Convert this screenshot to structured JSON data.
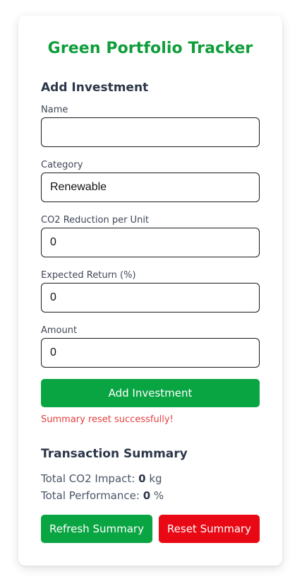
{
  "app": {
    "title": "Green Portfolio Tracker"
  },
  "form": {
    "heading": "Add Investment",
    "fields": {
      "name": {
        "label": "Name",
        "value": ""
      },
      "category": {
        "label": "Category",
        "value": "Renewable"
      },
      "co2": {
        "label": "CO2 Reduction per Unit",
        "value": "0"
      },
      "expected_return": {
        "label": "Expected Return (%)",
        "value": "0"
      },
      "amount": {
        "label": "Amount",
        "value": "0"
      }
    },
    "submit_label": "Add Investment",
    "status_message": "Summary reset successfully!"
  },
  "summary": {
    "heading": "Transaction Summary",
    "co2_label": "Total CO2 Impact:",
    "co2_value": "0",
    "co2_unit": "kg",
    "performance_label": "Total Performance:",
    "performance_value": "0",
    "performance_unit": "%",
    "refresh_label": "Refresh Summary",
    "reset_label": "Reset Summary"
  },
  "colors": {
    "brand_green": "#0f9d3a",
    "button_green": "#0aa543",
    "button_red": "#e80914",
    "error_text": "#e53e3e"
  }
}
